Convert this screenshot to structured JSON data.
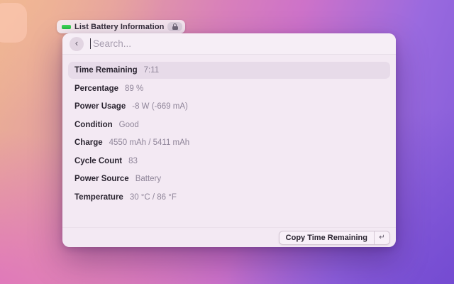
{
  "chip": {
    "label": "List Battery Information"
  },
  "search": {
    "placeholder": "Search..."
  },
  "icons": {
    "back_chevron": "‹",
    "enter_key": "↵"
  },
  "rows": [
    {
      "label": "Time Remaining",
      "value": "7:11",
      "selected": true
    },
    {
      "label": "Percentage",
      "value": "89 %"
    },
    {
      "label": "Power Usage",
      "value": "-8 W (-669 mA)"
    },
    {
      "label": "Condition",
      "value": "Good"
    },
    {
      "label": "Charge",
      "value": "4550 mAh / 5411 mAh"
    },
    {
      "label": "Cycle Count",
      "value": "83"
    },
    {
      "label": "Power Source",
      "value": "Battery"
    },
    {
      "label": "Temperature",
      "value": "30 °C / 86 °F"
    }
  ],
  "action_bar": {
    "primary_label": "Copy Time Remaining"
  },
  "colors": {
    "battery_green": "#35cd4e",
    "window_bg": "#f3e9f3",
    "selected_row": "#e7dbe9",
    "wall_peach": "#ecb292",
    "wall_magenta": "#d86fc6",
    "wall_purple": "#8059d7"
  }
}
